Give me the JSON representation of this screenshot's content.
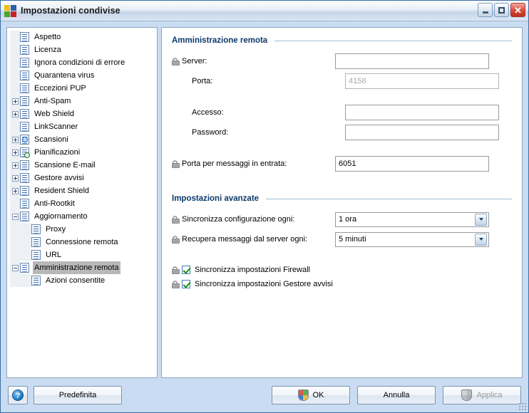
{
  "window": {
    "title": "Impostazioni condivise",
    "app_icon": "avg-logo-icon",
    "controls": {
      "minimize": "minimize-icon",
      "maximize": "maximize-icon",
      "close": "close-icon"
    }
  },
  "tree": {
    "items": [
      {
        "label": "Aspetto",
        "indent": 0,
        "toggle": "none",
        "icon": "document-icon",
        "selected": false
      },
      {
        "label": "Licenza",
        "indent": 0,
        "toggle": "none",
        "icon": "document-icon",
        "selected": false
      },
      {
        "label": "Ignora condizioni di errore",
        "indent": 0,
        "toggle": "none",
        "icon": "document-icon",
        "selected": false
      },
      {
        "label": "Quarantena virus",
        "indent": 0,
        "toggle": "none",
        "icon": "document-icon",
        "selected": false
      },
      {
        "label": "Eccezioni PUP",
        "indent": 0,
        "toggle": "none",
        "icon": "document-icon",
        "selected": false
      },
      {
        "label": "Anti-Spam",
        "indent": 0,
        "toggle": "plus",
        "icon": "document-icon",
        "selected": false
      },
      {
        "label": "Web Shield",
        "indent": 0,
        "toggle": "plus",
        "icon": "document-icon",
        "selected": false
      },
      {
        "label": "LinkScanner",
        "indent": 0,
        "toggle": "none",
        "icon": "document-icon",
        "selected": false
      },
      {
        "label": "Scansioni",
        "indent": 0,
        "toggle": "plus",
        "icon": "search-document-icon",
        "selected": false
      },
      {
        "label": "Pianificazioni",
        "indent": 0,
        "toggle": "plus",
        "icon": "schedule-document-icon",
        "selected": false
      },
      {
        "label": "Scansione E-mail",
        "indent": 0,
        "toggle": "plus",
        "icon": "document-icon",
        "selected": false
      },
      {
        "label": "Gestore avvisi",
        "indent": 0,
        "toggle": "plus",
        "icon": "document-icon",
        "selected": false
      },
      {
        "label": "Resident Shield",
        "indent": 0,
        "toggle": "plus",
        "icon": "document-icon",
        "selected": false
      },
      {
        "label": "Anti-Rootkit",
        "indent": 0,
        "toggle": "none",
        "icon": "document-icon",
        "selected": false
      },
      {
        "label": "Aggiornamento",
        "indent": 0,
        "toggle": "minus",
        "icon": "document-icon",
        "selected": false
      },
      {
        "label": "Proxy",
        "indent": 1,
        "toggle": "none",
        "icon": "document-icon",
        "selected": false
      },
      {
        "label": "Connessione remota",
        "indent": 1,
        "toggle": "none",
        "icon": "document-icon",
        "selected": false
      },
      {
        "label": "URL",
        "indent": 1,
        "toggle": "none",
        "icon": "document-icon",
        "selected": false
      },
      {
        "label": "Amministrazione remota",
        "indent": 0,
        "toggle": "minus",
        "icon": "document-icon",
        "selected": true
      },
      {
        "label": "Azioni consentite",
        "indent": 1,
        "toggle": "none",
        "icon": "document-icon",
        "selected": false
      }
    ]
  },
  "content": {
    "section1_title": "Amministrazione remota",
    "section2_title": "Impostazioni avanzate",
    "fields": {
      "server_label": "Server:",
      "server_value": "",
      "porta_label": "Porta:",
      "porta_value": "4158",
      "accesso_label": "Accesso:",
      "accesso_value": "",
      "password_label": "Password:",
      "password_value": "",
      "porta_msg_label": "Porta per messaggi in entrata:",
      "porta_msg_value": "6051",
      "sync_conf_label": "Sincronizza configurazione ogni:",
      "sync_conf_value": "1 ora",
      "recupera_label": "Recupera messaggi dal server ogni:",
      "recupera_value": "5 minuti"
    },
    "checkboxes": [
      {
        "label": "Sincronizza impostazioni Firewall",
        "checked": true
      },
      {
        "label": "Sincronizza impostazioni Gestore avvisi",
        "checked": true
      }
    ]
  },
  "footer": {
    "help_label": "?",
    "default_label": "Predefinita",
    "ok_label": "OK",
    "cancel_label": "Annulla",
    "apply_label": "Applica"
  },
  "colors": {
    "dialog_bg": "#c9dcf2",
    "heading": "#0b3a6b",
    "selection": "#b8b8b8",
    "check_green": "#159015"
  }
}
